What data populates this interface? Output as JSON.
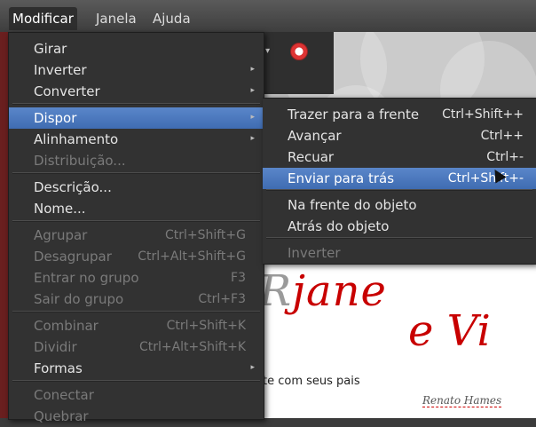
{
  "menubar": {
    "items": [
      "Modificar",
      "Janela",
      "Ajuda"
    ]
  },
  "main_menu": {
    "items": [
      {
        "label": "Girar",
        "shortcut": "",
        "submenu": false,
        "disabled": false,
        "highlight": false
      },
      {
        "label": "Inverter",
        "shortcut": "",
        "submenu": true,
        "disabled": false,
        "highlight": false
      },
      {
        "label": "Converter",
        "shortcut": "",
        "submenu": true,
        "disabled": false,
        "highlight": false
      },
      {
        "label": "Dispor",
        "shortcut": "",
        "submenu": true,
        "disabled": false,
        "highlight": true
      },
      {
        "label": "Alinhamento",
        "shortcut": "",
        "submenu": true,
        "disabled": false,
        "highlight": false
      },
      {
        "label": "Distribuição...",
        "shortcut": "",
        "submenu": false,
        "disabled": true,
        "highlight": false
      },
      {
        "label": "Descrição...",
        "shortcut": "",
        "submenu": false,
        "disabled": false,
        "highlight": false
      },
      {
        "label": "Nome...",
        "shortcut": "",
        "submenu": false,
        "disabled": false,
        "highlight": false
      },
      {
        "label": "Agrupar",
        "shortcut": "Ctrl+Shift+G",
        "submenu": false,
        "disabled": true,
        "highlight": false
      },
      {
        "label": "Desagrupar",
        "shortcut": "Ctrl+Alt+Shift+G",
        "submenu": false,
        "disabled": true,
        "highlight": false
      },
      {
        "label": "Entrar no grupo",
        "shortcut": "F3",
        "submenu": false,
        "disabled": true,
        "highlight": false
      },
      {
        "label": "Sair do grupo",
        "shortcut": "Ctrl+F3",
        "submenu": false,
        "disabled": true,
        "highlight": false
      },
      {
        "label": "Combinar",
        "shortcut": "Ctrl+Shift+K",
        "submenu": false,
        "disabled": true,
        "highlight": false
      },
      {
        "label": "Dividir",
        "shortcut": "Ctrl+Alt+Shift+K",
        "submenu": false,
        "disabled": true,
        "highlight": false
      },
      {
        "label": "Formas",
        "shortcut": "",
        "submenu": true,
        "disabled": false,
        "highlight": false
      },
      {
        "label": "Conectar",
        "shortcut": "",
        "submenu": false,
        "disabled": true,
        "highlight": false
      },
      {
        "label": "Quebrar",
        "shortcut": "",
        "submenu": false,
        "disabled": true,
        "highlight": false
      }
    ]
  },
  "sub_menu": {
    "items": [
      {
        "label": "Trazer para a frente",
        "shortcut": "Ctrl+Shift++",
        "disabled": false,
        "highlight": false
      },
      {
        "label": "Avançar",
        "shortcut": "Ctrl++",
        "disabled": false,
        "highlight": false
      },
      {
        "label": "Recuar",
        "shortcut": "Ctrl+-",
        "disabled": false,
        "highlight": false
      },
      {
        "label": "Enviar para trás",
        "shortcut": "Ctrl+Shift+-",
        "disabled": false,
        "highlight": true
      },
      {
        "label": "Na frente do objeto",
        "shortcut": "",
        "disabled": false,
        "highlight": false
      },
      {
        "label": "Atrás do objeto",
        "shortcut": "",
        "disabled": false,
        "highlight": false
      },
      {
        "label": "Inverter",
        "shortcut": "",
        "disabled": true,
        "highlight": false
      }
    ]
  },
  "document": {
    "script_line1_prefix": "R",
    "script_line1": "jane",
    "script_line2": "e Vi",
    "body_text": "te com seus pais",
    "signature": "Renato Hames"
  },
  "colors": {
    "highlight": "#4a78bf",
    "menu_bg": "#323232",
    "script_red": "#c80000"
  }
}
